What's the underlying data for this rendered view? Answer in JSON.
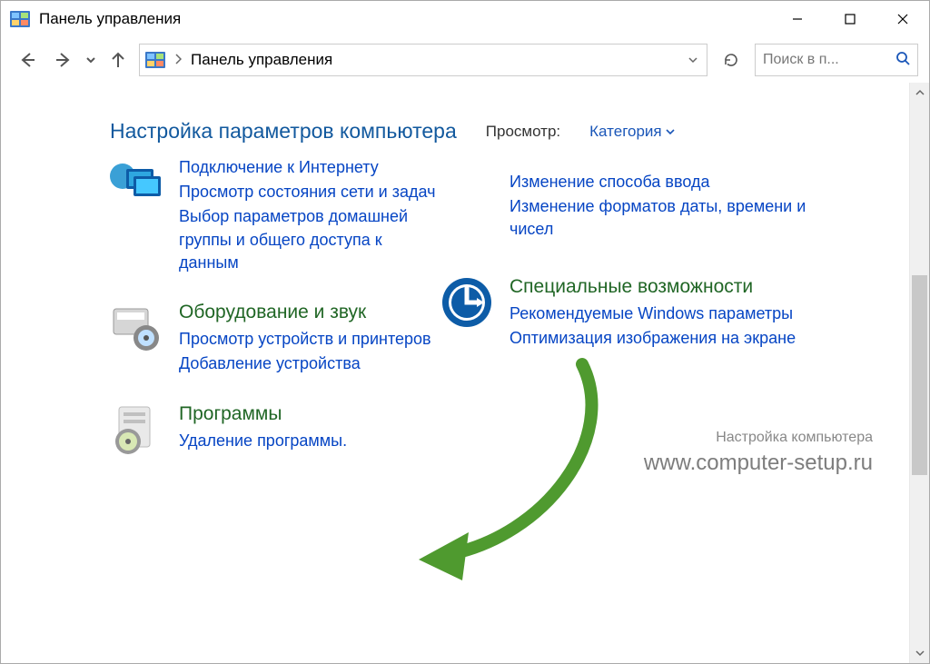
{
  "window": {
    "title": "Панель управления"
  },
  "nav": {
    "breadcrumb": "Панель управления",
    "search_placeholder": "Поиск в п..."
  },
  "header": {
    "title": "Настройка параметров компьютера",
    "view_label": "Просмотр:",
    "view_value": "Категория"
  },
  "left_column": {
    "network": {
      "links": [
        "Подключение к Интернету",
        "Просмотр состояния сети и задач",
        "Выбор параметров домашней группы и общего доступа к данным"
      ]
    },
    "hardware": {
      "title": "Оборудование и звук",
      "links": [
        "Просмотр устройств и принтеров",
        "Добавление устройства"
      ]
    },
    "programs": {
      "title": "Программы",
      "links": [
        "Удаление программы."
      ]
    }
  },
  "right_column": {
    "top_links": [
      "Изменение способа ввода",
      "Изменение форматов даты, времени и чисел"
    ],
    "ease": {
      "title": "Специальные возможности",
      "links": [
        "Рекомендуемые Windows параметры",
        "Оптимизация изображения на экране"
      ]
    }
  },
  "watermark": {
    "line1": "Настройка компьютера",
    "line2": "www.computer-setup.ru"
  }
}
